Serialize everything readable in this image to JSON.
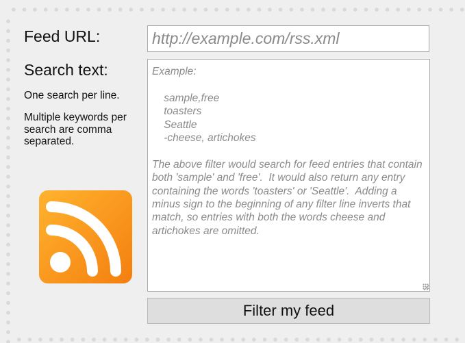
{
  "form": {
    "feed_url_label": "Feed URL:",
    "feed_url_placeholder": "http://example.com/rss.xml",
    "feed_url_value": "",
    "search_text_label": "Search text:",
    "help_one_per_line": "One search per line.",
    "help_keywords": "Multiple keywords per search are comma separated.",
    "search_text_value": "",
    "search_text_placeholder": "Example:\n\n    sample,free\n    toasters\n    Seattle\n    -cheese, artichokes\n\nThe above filter would search for feed entries that contain both 'sample' and 'free'.  It would also return any entry containing the words 'toasters' or 'Seattle'.  Adding a minus sign to the beginning of any filter line inverts that match, so entries with both the words cheese and artichokes are omitted.",
    "submit_label": "Filter my feed"
  },
  "icons": {
    "rss": "rss-feed-icon"
  },
  "colors": {
    "page_background": "#efefef",
    "rss_orange_light": "#ffb32e",
    "rss_orange_dark": "#f47f10",
    "button_background": "#dedede",
    "placeholder_text": "#8a8a8a"
  }
}
